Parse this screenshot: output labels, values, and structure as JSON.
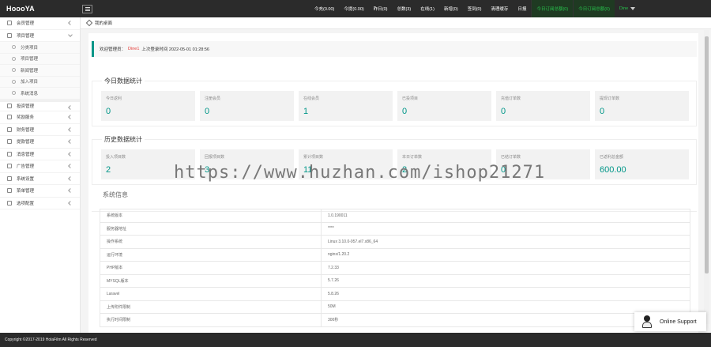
{
  "brand": "HoooYA",
  "topbar": {
    "items": [
      {
        "label": "今充(0.00)"
      },
      {
        "label": "今提(0.00)"
      },
      {
        "label": "昨日(0)"
      },
      {
        "label": "总数(3)"
      },
      {
        "label": "在线(1)"
      },
      {
        "label": "新增(0)"
      },
      {
        "label": "签到(0)"
      },
      {
        "label": "清理缓存"
      },
      {
        "label": "日报"
      }
    ],
    "green_items": [
      {
        "label": "今日订阅总额(0)"
      },
      {
        "label": "今日订阅总额(0)"
      }
    ],
    "user": "Dine"
  },
  "sidebar": {
    "items": [
      {
        "label": "会员管理",
        "type": "item",
        "state": "collapsed"
      },
      {
        "label": "项目管理",
        "type": "item",
        "state": "open"
      },
      {
        "label": "分类项目",
        "type": "sub"
      },
      {
        "label": "项目管理",
        "type": "sub"
      },
      {
        "label": "新闻管理",
        "type": "sub"
      },
      {
        "label": "加入项目",
        "type": "sub"
      },
      {
        "label": "系统消息",
        "type": "sub"
      },
      {
        "label": "投资管理",
        "type": "item",
        "state": "collapsed"
      },
      {
        "label": "奖励服务",
        "type": "item",
        "state": "collapsed"
      },
      {
        "label": "财务管理",
        "type": "item",
        "state": "collapsed"
      },
      {
        "label": "提款管理",
        "type": "item",
        "state": "collapsed"
      },
      {
        "label": "消息管理",
        "type": "item",
        "state": "collapsed"
      },
      {
        "label": "广告管理",
        "type": "item",
        "state": "collapsed"
      },
      {
        "label": "系统设置",
        "type": "item",
        "state": "collapsed"
      },
      {
        "label": "菜单管理",
        "type": "item",
        "state": "collapsed"
      },
      {
        "label": "选项配置",
        "type": "item",
        "state": "collapsed"
      }
    ]
  },
  "tab": {
    "label": "我的桌面"
  },
  "welcome": {
    "prefix": "欢迎管理员：",
    "user": "Dine1",
    "suffix": "上次登录时间 2022-05-01 01:28:56"
  },
  "today_stats": {
    "title": "今日数据统计",
    "cards": [
      {
        "label": "今日返利",
        "value": "0"
      },
      {
        "label": "注册会员",
        "value": "0"
      },
      {
        "label": "在线会员",
        "value": "1"
      },
      {
        "label": "已投项目",
        "value": "0"
      },
      {
        "label": "充值订单数",
        "value": "0"
      },
      {
        "label": "提现订单数",
        "value": "0"
      }
    ]
  },
  "history_stats": {
    "title": "历史数据统计",
    "cards": [
      {
        "label": "投入项目数",
        "value": "2"
      },
      {
        "label": "回报项目数",
        "value": "3"
      },
      {
        "label": "累计项目数",
        "value": "11"
      },
      {
        "label": "本日订单数",
        "value": "2"
      },
      {
        "label": "已结订单数",
        "value": "0"
      },
      {
        "label": "已返利总金额",
        "value": "600.00"
      }
    ]
  },
  "system": {
    "title": "系统信息",
    "rows": [
      {
        "key": "系统版本",
        "value": "1.0.190011"
      },
      {
        "key": "服务器地址",
        "value": "****"
      },
      {
        "key": "操作系统",
        "value": "Linux 3.10.0-957.el7.x86_64"
      },
      {
        "key": "运行环境",
        "value": "nginx/1.20.2"
      },
      {
        "key": "PHP版本",
        "value": "7.2.33"
      },
      {
        "key": "MYSQL版本",
        "value": "5.7.26"
      },
      {
        "key": "Laravel",
        "value": "5.8.26"
      },
      {
        "key": "上传附件限制",
        "value": "50M"
      },
      {
        "key": "执行时间限制",
        "value": "300秒"
      }
    ]
  },
  "watermark": "https://www.huzhan.com/ishop21271",
  "footer": "Copyright ©2017-2019 HolaFilm All Rights Reserved",
  "support": {
    "label": "Online Support"
  }
}
